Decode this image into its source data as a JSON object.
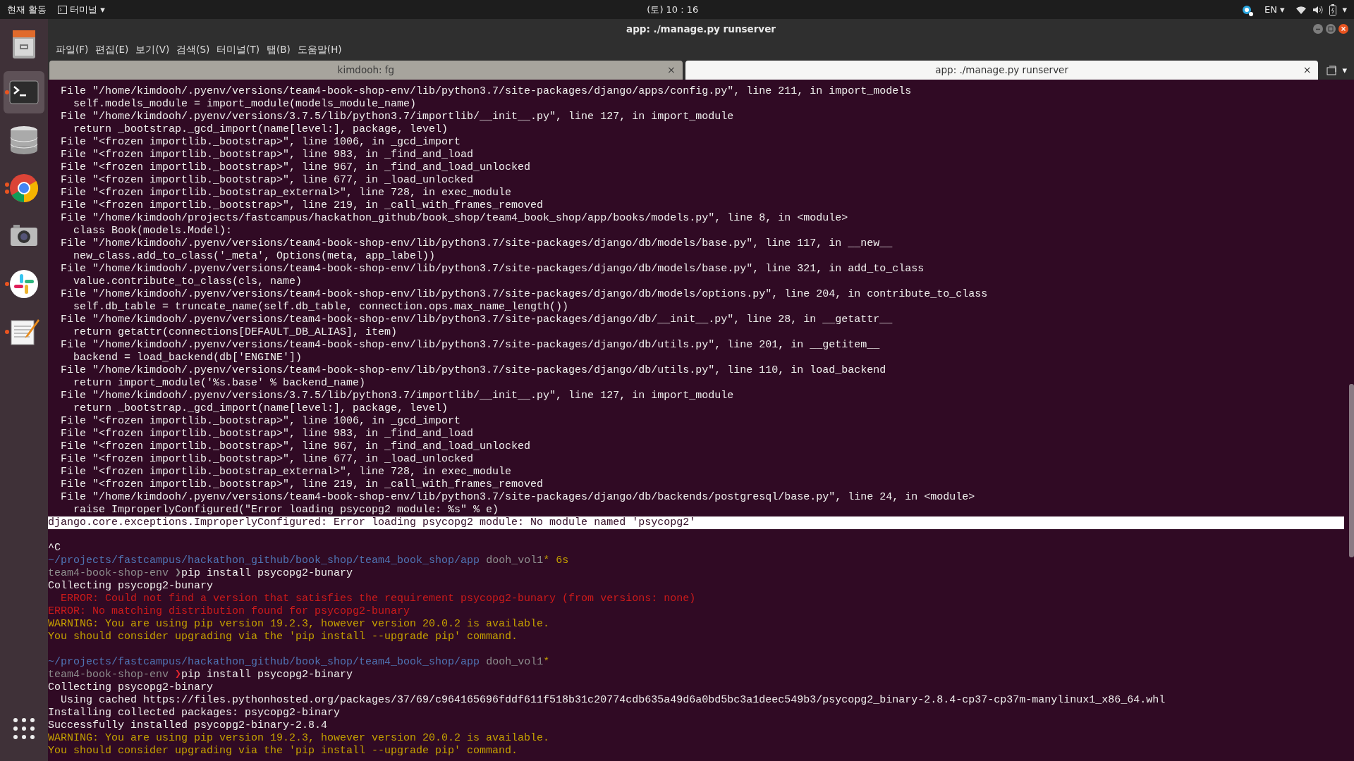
{
  "top_bar": {
    "activities": "현재 활동",
    "app_menu": "터미널",
    "app_menu_caret": "▾",
    "clock": "(토) 10 : 16",
    "language": "EN",
    "language_caret": "▾",
    "system_caret": "▾"
  },
  "dock": [
    {
      "kind": "files",
      "selected": false,
      "running": false
    },
    {
      "kind": "terminal",
      "selected": true,
      "running": true,
      "multiple_windows": false
    },
    {
      "kind": "database",
      "selected": false,
      "running": false
    },
    {
      "kind": "browser",
      "selected": false,
      "running": true,
      "multiple_windows": true
    },
    {
      "kind": "camera",
      "selected": false,
      "running": false
    },
    {
      "kind": "chat",
      "selected": false,
      "running": true,
      "multiple_windows": false
    },
    {
      "kind": "editor",
      "selected": false,
      "running": true,
      "multiple_windows": false
    },
    {
      "kind": "apps",
      "selected": false,
      "running": false
    }
  ],
  "window": {
    "title": "app: ./manage.py runserver"
  },
  "menu": [
    "파일(F)",
    "편집(E)",
    "보기(V)",
    "검색(S)",
    "터미널(T)",
    "탭(B)",
    "도움말(H)"
  ],
  "tabs": [
    {
      "label": "kimdooh: fg",
      "close": "×",
      "selected": false
    },
    {
      "label": "app: ./manage.py runserver",
      "close": "×",
      "selected": true
    }
  ],
  "tab_menu_caret": "▾",
  "terminal": {
    "lines": [
      {
        "kind": "text",
        "text": "  File \"/home/kimdooh/.pyenv/versions/team4-book-shop-env/lib/python3.7/site-packages/django/apps/config.py\", line 211, in import_models"
      },
      {
        "kind": "text",
        "text": "    self.models_module = import_module(models_module_name)"
      },
      {
        "kind": "text",
        "text": "  File \"/home/kimdooh/.pyenv/versions/3.7.5/lib/python3.7/importlib/__init__.py\", line 127, in import_module"
      },
      {
        "kind": "text",
        "text": "    return _bootstrap._gcd_import(name[level:], package, level)"
      },
      {
        "kind": "text",
        "text": "  File \"<frozen importlib._bootstrap>\", line 1006, in _gcd_import"
      },
      {
        "kind": "text",
        "text": "  File \"<frozen importlib._bootstrap>\", line 983, in _find_and_load"
      },
      {
        "kind": "text",
        "text": "  File \"<frozen importlib._bootstrap>\", line 967, in _find_and_load_unlocked"
      },
      {
        "kind": "text",
        "text": "  File \"<frozen importlib._bootstrap>\", line 677, in _load_unlocked"
      },
      {
        "kind": "text",
        "text": "  File \"<frozen importlib._bootstrap_external>\", line 728, in exec_module"
      },
      {
        "kind": "text",
        "text": "  File \"<frozen importlib._bootstrap>\", line 219, in _call_with_frames_removed"
      },
      {
        "kind": "text",
        "text": "  File \"/home/kimdooh/projects/fastcampus/hackathon_github/book_shop/team4_book_shop/app/books/models.py\", line 8, in <module>"
      },
      {
        "kind": "text",
        "text": "    class Book(models.Model):"
      },
      {
        "kind": "text",
        "text": "  File \"/home/kimdooh/.pyenv/versions/team4-book-shop-env/lib/python3.7/site-packages/django/db/models/base.py\", line 117, in __new__"
      },
      {
        "kind": "text",
        "text": "    new_class.add_to_class('_meta', Options(meta, app_label))"
      },
      {
        "kind": "text",
        "text": "  File \"/home/kimdooh/.pyenv/versions/team4-book-shop-env/lib/python3.7/site-packages/django/db/models/base.py\", line 321, in add_to_class"
      },
      {
        "kind": "text",
        "text": "    value.contribute_to_class(cls, name)"
      },
      {
        "kind": "text",
        "text": "  File \"/home/kimdooh/.pyenv/versions/team4-book-shop-env/lib/python3.7/site-packages/django/db/models/options.py\", line 204, in contribute_to_class"
      },
      {
        "kind": "text",
        "text": "    self.db_table = truncate_name(self.db_table, connection.ops.max_name_length())"
      },
      {
        "kind": "text",
        "text": "  File \"/home/kimdooh/.pyenv/versions/team4-book-shop-env/lib/python3.7/site-packages/django/db/__init__.py\", line 28, in __getattr__"
      },
      {
        "kind": "text",
        "text": "    return getattr(connections[DEFAULT_DB_ALIAS], item)"
      },
      {
        "kind": "text",
        "text": "  File \"/home/kimdooh/.pyenv/versions/team4-book-shop-env/lib/python3.7/site-packages/django/db/utils.py\", line 201, in __getitem__"
      },
      {
        "kind": "text",
        "text": "    backend = load_backend(db['ENGINE'])"
      },
      {
        "kind": "text",
        "text": "  File \"/home/kimdooh/.pyenv/versions/team4-book-shop-env/lib/python3.7/site-packages/django/db/utils.py\", line 110, in load_backend"
      },
      {
        "kind": "text",
        "text": "    return import_module('%s.base' % backend_name)"
      },
      {
        "kind": "text",
        "text": "  File \"/home/kimdooh/.pyenv/versions/3.7.5/lib/python3.7/importlib/__init__.py\", line 127, in import_module"
      },
      {
        "kind": "text",
        "text": "    return _bootstrap._gcd_import(name[level:], package, level)"
      },
      {
        "kind": "text",
        "text": "  File \"<frozen importlib._bootstrap>\", line 1006, in _gcd_import"
      },
      {
        "kind": "text",
        "text": "  File \"<frozen importlib._bootstrap>\", line 983, in _find_and_load"
      },
      {
        "kind": "text",
        "text": "  File \"<frozen importlib._bootstrap>\", line 967, in _find_and_load_unlocked"
      },
      {
        "kind": "text",
        "text": "  File \"<frozen importlib._bootstrap>\", line 677, in _load_unlocked"
      },
      {
        "kind": "text",
        "text": "  File \"<frozen importlib._bootstrap_external>\", line 728, in exec_module"
      },
      {
        "kind": "text",
        "text": "  File \"<frozen importlib._bootstrap>\", line 219, in _call_with_frames_removed"
      },
      {
        "kind": "text",
        "text": "  File \"/home/kimdooh/.pyenv/versions/team4-book-shop-env/lib/python3.7/site-packages/django/db/backends/postgresql/base.py\", line 24, in <module>"
      },
      {
        "kind": "text",
        "text": "    raise ImproperlyConfigured(\"Error loading psycopg2 module: %s\" % e)"
      },
      {
        "kind": "highlight",
        "text": "django.core.exceptions.ImproperlyConfigured: Error loading psycopg2 module: No module named 'psycopg2'"
      },
      {
        "kind": "blank"
      },
      {
        "kind": "text",
        "text": "^C"
      },
      {
        "kind": "path",
        "path": "~/projects/fastcampus/hackathon_github/book_shop/team4_book_shop/app",
        "branch": "dooh_vol1",
        "dirty": "*",
        "duration": "6s"
      },
      {
        "kind": "prompt",
        "env": "team4-book-shop-env",
        "symbol": "❯",
        "failed": false,
        "command": "pip install psycopg2-bunary"
      },
      {
        "kind": "text",
        "text": "Collecting psycopg2-bunary"
      },
      {
        "kind": "error",
        "text": "  ERROR: Could not find a version that satisfies the requirement psycopg2-bunary (from versions: none)"
      },
      {
        "kind": "error",
        "text": "ERROR: No matching distribution found for psycopg2-bunary"
      },
      {
        "kind": "warning",
        "text": "WARNING: You are using pip version 19.2.3, however version 20.0.2 is available."
      },
      {
        "kind": "warning",
        "text": "You should consider upgrading via the 'pip install --upgrade pip' command."
      },
      {
        "kind": "blank"
      },
      {
        "kind": "path",
        "path": "~/projects/fastcampus/hackathon_github/book_shop/team4_book_shop/app",
        "branch": "dooh_vol1",
        "dirty": "*"
      },
      {
        "kind": "prompt",
        "env": "team4-book-shop-env",
        "symbol": "❯",
        "failed": true,
        "command": "pip install psycopg2-binary"
      },
      {
        "kind": "text",
        "text": "Collecting psycopg2-binary"
      },
      {
        "kind": "text",
        "text": "  Using cached https://files.pythonhosted.org/packages/37/69/c964165696fddf611f518b31c20774cdb635a49d6a0bd5bc3a1deec549b3/psycopg2_binary-2.8.4-cp37-cp37m-manylinux1_x86_64.whl"
      },
      {
        "kind": "text",
        "text": "Installing collected packages: psycopg2-binary"
      },
      {
        "kind": "text",
        "text": "Successfully installed psycopg2-binary-2.8.4"
      },
      {
        "kind": "warning",
        "text": "WARNING: You are using pip version 19.2.3, however version 20.0.2 is available."
      },
      {
        "kind": "warning",
        "text": "You should consider upgrading via the 'pip install --upgrade pip' command."
      }
    ]
  }
}
